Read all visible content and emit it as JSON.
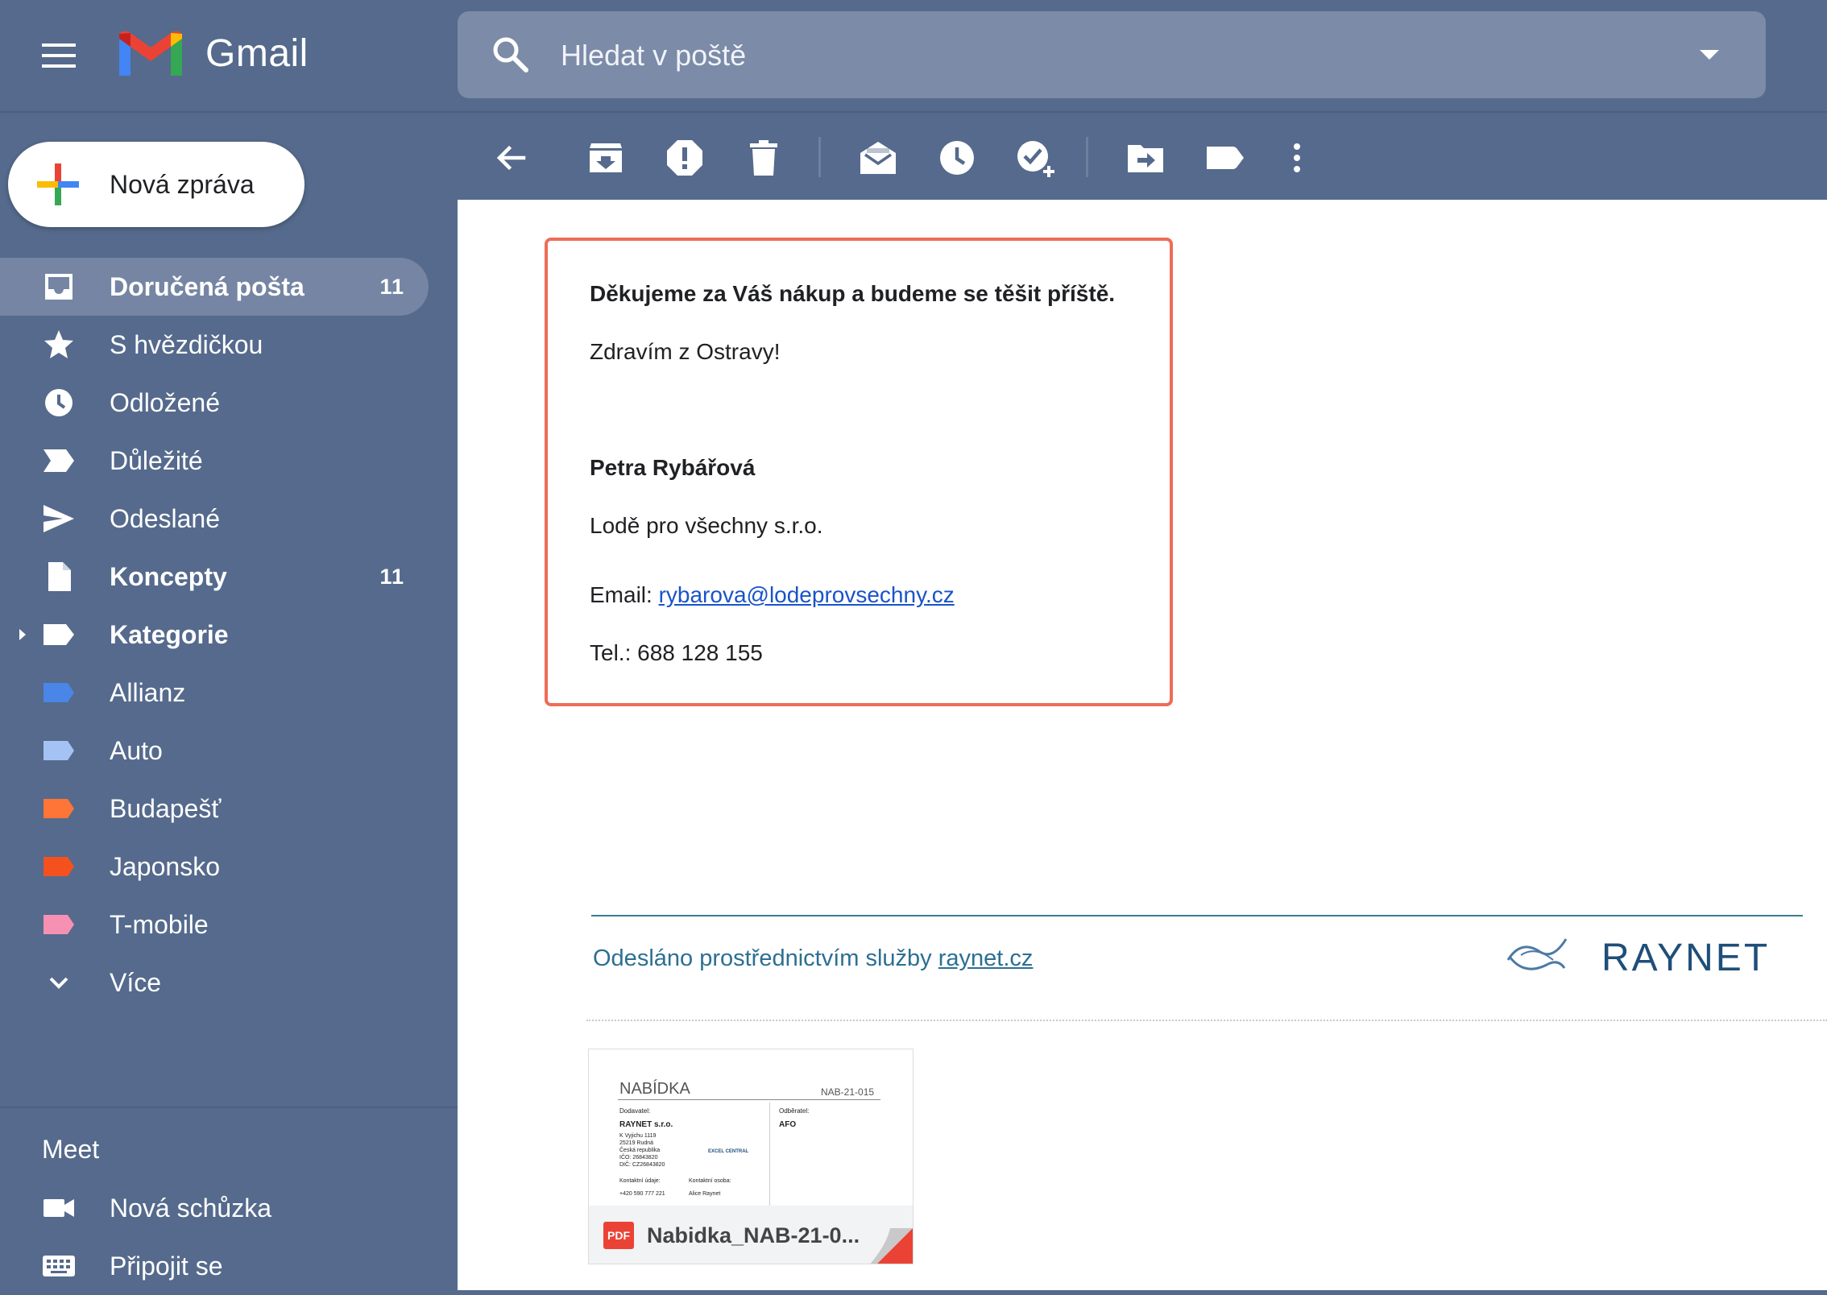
{
  "app": {
    "brand": "Gmail",
    "search_placeholder": "Hledat v poště"
  },
  "compose": {
    "label": "Nová zpráva"
  },
  "nav": {
    "items": [
      {
        "label": "Doručená pošta",
        "count": "11",
        "icon": "inbox-icon",
        "active": true,
        "bold": true
      },
      {
        "label": "S hvězdičkou",
        "icon": "star-icon"
      },
      {
        "label": "Odložené",
        "icon": "clock-icon"
      },
      {
        "label": "Důležité",
        "icon": "important-icon"
      },
      {
        "label": "Odeslané",
        "icon": "send-icon"
      },
      {
        "label": "Koncepty",
        "count": "11",
        "icon": "draft-icon",
        "bold": true
      },
      {
        "label": "Kategorie",
        "icon": "label-icon",
        "bold": true
      },
      {
        "label": "Allianz",
        "icon": "label-icon",
        "color": "#4a86e8"
      },
      {
        "label": "Auto",
        "icon": "label-icon",
        "color": "#a4c2f4"
      },
      {
        "label": "Budapešť",
        "icon": "label-icon",
        "color": "#ff7537"
      },
      {
        "label": "Japonsko",
        "icon": "label-icon",
        "color": "#f4511e"
      },
      {
        "label": "T-mobile",
        "icon": "label-icon",
        "color": "#f691b3"
      },
      {
        "label": "Více",
        "icon": "chevron-down-icon"
      }
    ]
  },
  "meet": {
    "title": "Meet",
    "items": [
      {
        "label": "Nová schůzka",
        "icon": "video-icon"
      },
      {
        "label": "Připojit se",
        "icon": "keyboard-icon"
      }
    ]
  },
  "toolbar": {
    "buttons": [
      "back-icon",
      "archive-icon",
      "report-spam-icon",
      "delete-icon",
      "mark-unread-icon",
      "snooze-icon",
      "add-to-tasks-icon",
      "move-to-icon",
      "label-as-icon",
      "more-icon"
    ]
  },
  "message": {
    "thanks": "Děkujeme za Váš nákup a budeme se těšit příště.",
    "greeting": "Zdravím z Ostravy!",
    "signature_name": "Petra Rybářová",
    "company": "Lodě pro všechny s.r.o.",
    "email_label": "Email: ",
    "email": "rybarova@lodeprovsechny.cz",
    "phone": "Tel.: 688 128 155"
  },
  "footer": {
    "text": "Odesláno prostřednictvím služby ",
    "link": "raynet.cz",
    "logo_text": "RAYNET"
  },
  "attachment": {
    "name": "Nabidka_NAB-21-0...",
    "type_badge": "PDF",
    "preview": {
      "title": "NABÍDKA",
      "number": "NAB-21-015",
      "supplier_label": "Dodavatel:",
      "supplier": "RAYNET s.r.o.",
      "supplier_lines": [
        "K Vyjichu 1119",
        "25219 Rudná",
        "Česká republika",
        "IČO:      26843820",
        "DIČ:      CZ26843820"
      ],
      "buyer_label": "Odběratel:",
      "buyer": "AFO",
      "contact_label": "Kontaktní údaje:",
      "contact_person_label": "Kontaktní osoba:",
      "phone": "+420 590 777 221",
      "person": "Alice Raynet",
      "badge": "EXCEL CENTRAL"
    }
  }
}
